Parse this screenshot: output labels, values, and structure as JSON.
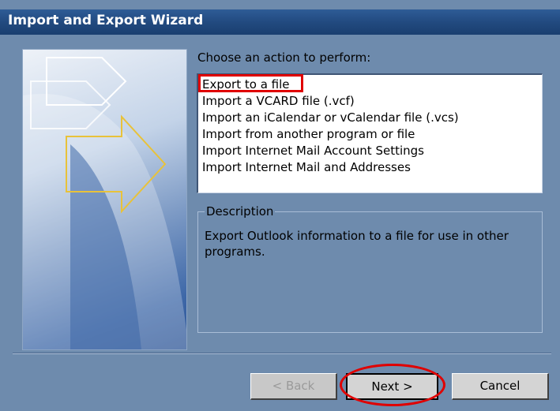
{
  "window": {
    "title": "Import and Export Wizard"
  },
  "action": {
    "prompt": "Choose an action to perform:",
    "items": [
      "Export to a file",
      "Import a VCARD file (.vcf)",
      "Import an iCalendar or vCalendar file (.vcs)",
      "Import from another program or file",
      "Import Internet Mail Account Settings",
      "Import Internet Mail and Addresses"
    ],
    "selected": "Export to a file"
  },
  "description": {
    "title": "Description",
    "text": "Export Outlook information to a file for use in other programs."
  },
  "buttons": {
    "back": "< Back",
    "next": "Next >",
    "cancel": "Cancel"
  },
  "colors": {
    "dialog_background": "#6e8bad",
    "title_bar": "#224a80",
    "highlight_annotation": "#e00000"
  }
}
